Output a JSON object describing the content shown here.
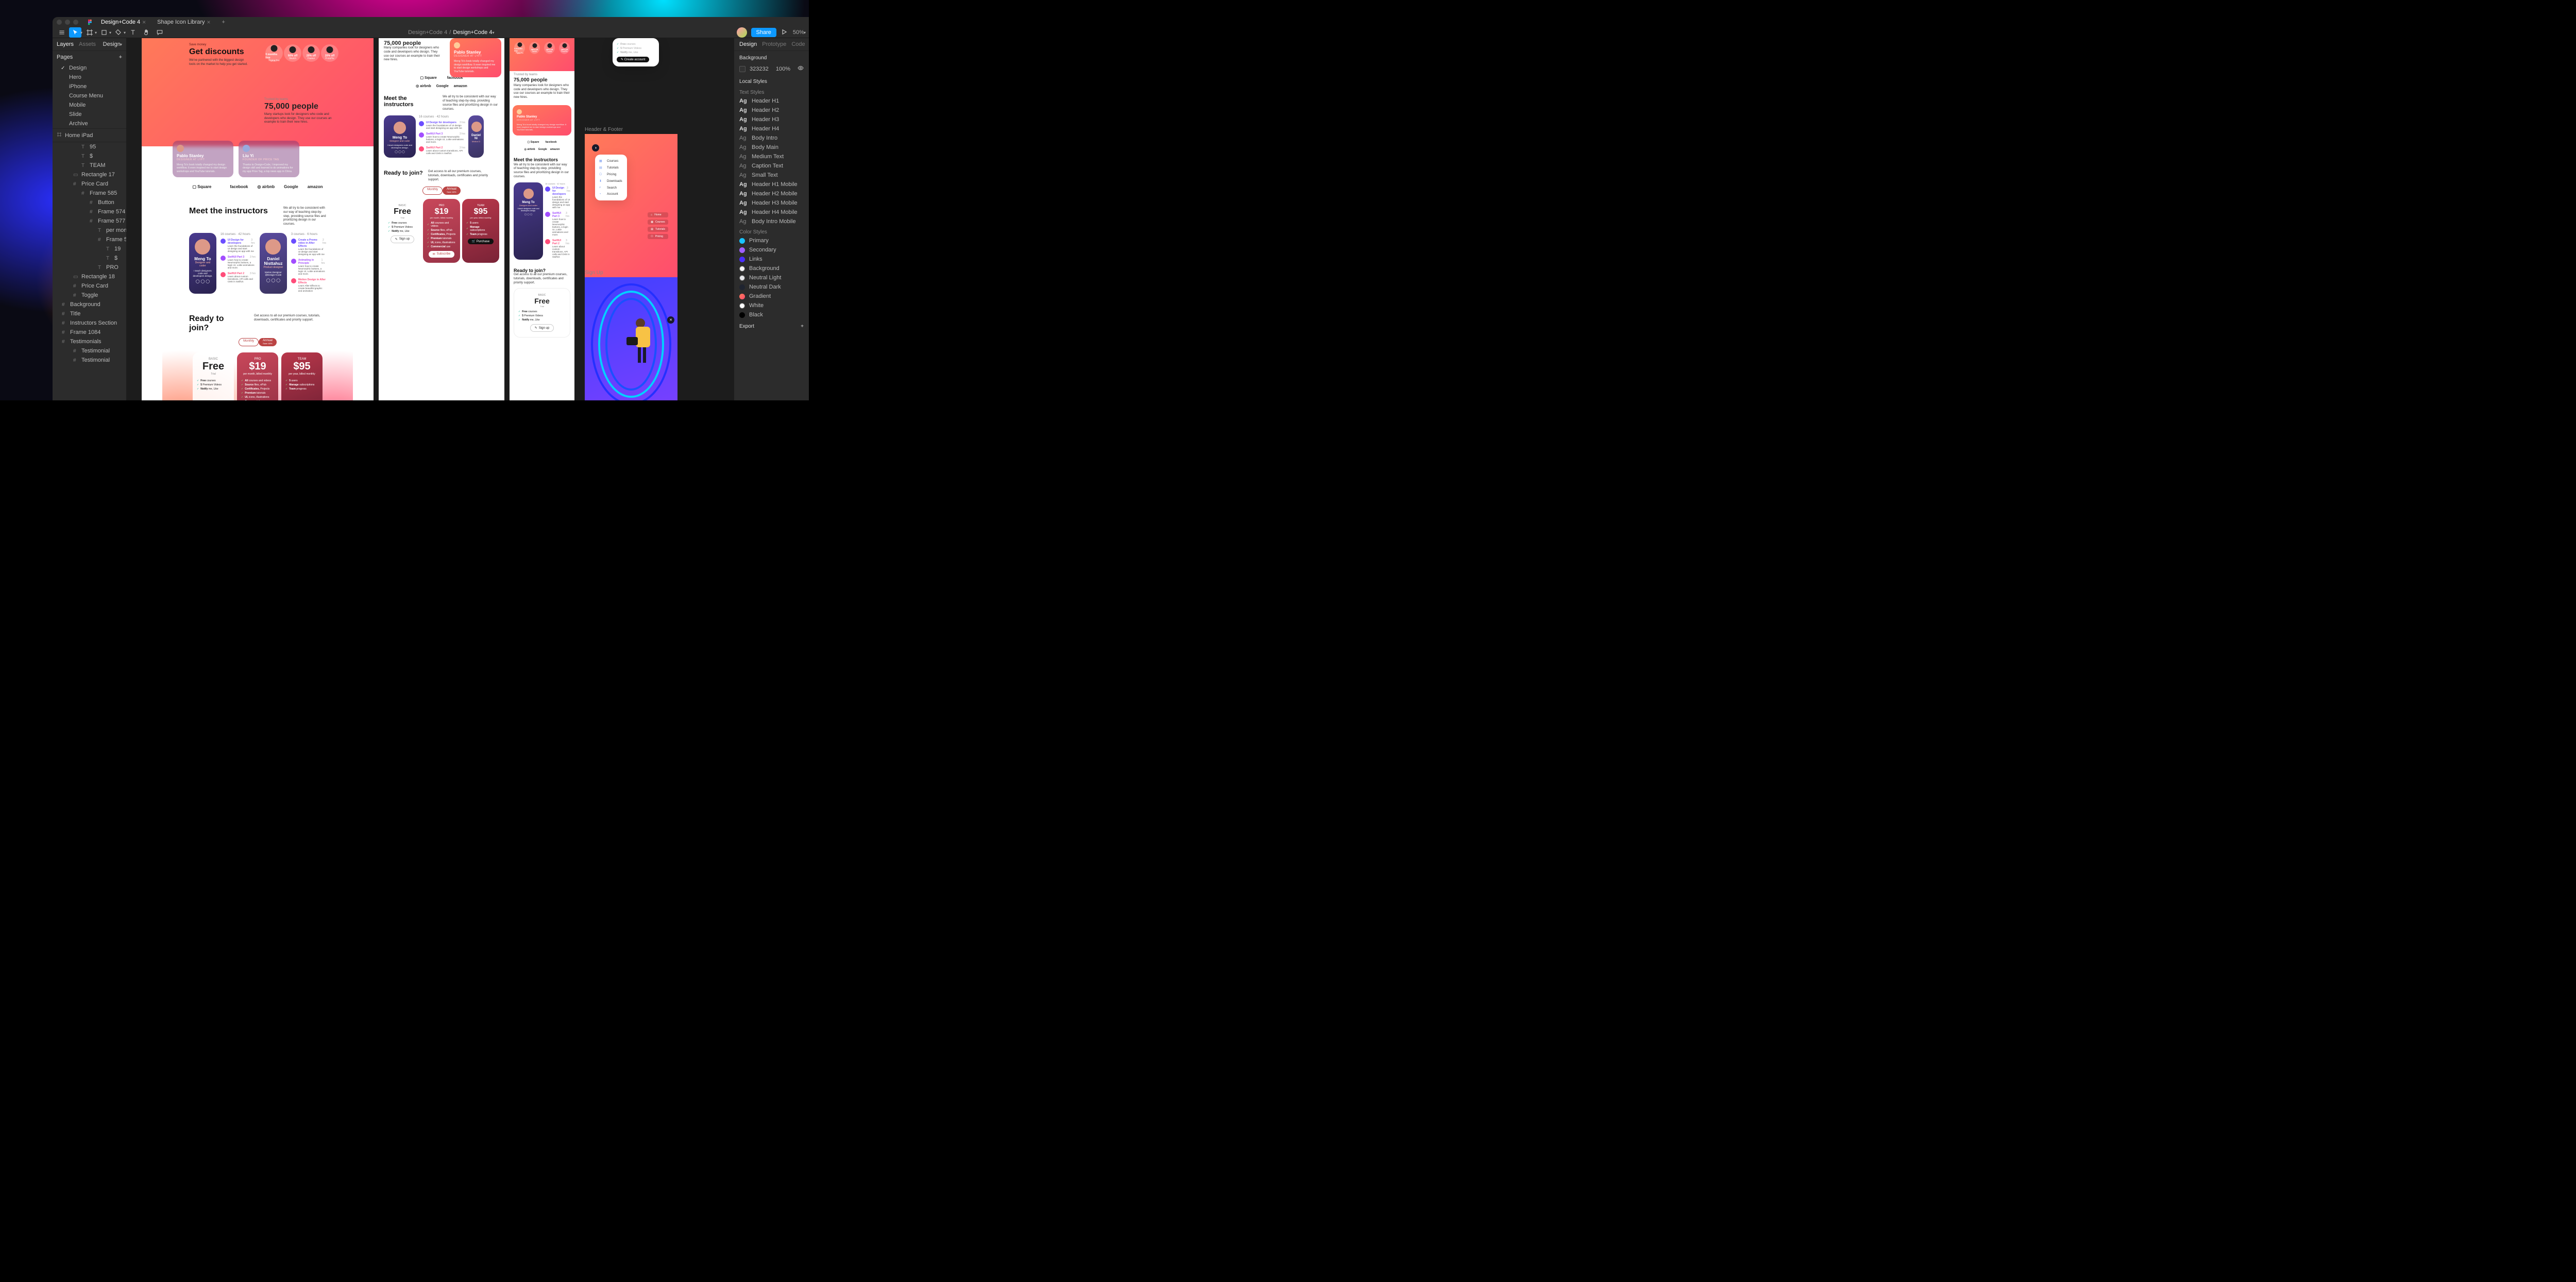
{
  "window": {
    "tab1": "Design+Code 4",
    "tab2": "Shape Icon Library",
    "breadcrumb_root": "Design+Code 4",
    "breadcrumb_page": "Design+Code 4",
    "share": "Share",
    "zoom": "50%"
  },
  "left": {
    "tabs": [
      "Layers",
      "Assets"
    ],
    "design_menu": "Design",
    "pages_label": "Pages",
    "pages": [
      "Design",
      "Hero",
      "iPhone",
      "Course Menu",
      "Mobile",
      "Slide",
      "Archive"
    ],
    "home_ipad": "Home iPad",
    "layers": [
      {
        "n": "95",
        "t": "T",
        "d": 2
      },
      {
        "n": "$",
        "t": "T",
        "d": 2
      },
      {
        "n": "TEAM",
        "t": "T",
        "d": 2
      },
      {
        "n": "Rectangle 17",
        "t": "R",
        "d": 1
      },
      {
        "n": "Price Card",
        "t": "F",
        "d": 1
      },
      {
        "n": "Frame 585",
        "t": "F",
        "d": 2
      },
      {
        "n": "Button",
        "t": "F",
        "d": 3
      },
      {
        "n": "Frame 574",
        "t": "F",
        "d": 3
      },
      {
        "n": "Frame 577",
        "t": "F",
        "d": 3
      },
      {
        "n": "per month, ...",
        "t": "T",
        "d": 4
      },
      {
        "n": "Frame 576",
        "t": "F",
        "d": 4
      },
      {
        "n": "19",
        "t": "T",
        "d": 5
      },
      {
        "n": "$",
        "t": "T",
        "d": 5
      },
      {
        "n": "PRO",
        "t": "T",
        "d": 4
      },
      {
        "n": "Rectangle 18",
        "t": "R",
        "d": 1
      },
      {
        "n": "Price Card",
        "t": "F",
        "d": 1
      },
      {
        "n": "Toggle",
        "t": "F",
        "d": 1
      },
      {
        "n": "Background",
        "t": "F",
        "d": 0
      },
      {
        "n": "Title",
        "t": "F",
        "d": 0
      },
      {
        "n": "Instructors Section",
        "t": "F",
        "d": 0
      },
      {
        "n": "Frame 1084",
        "t": "F",
        "d": 0
      },
      {
        "n": "Testimonials",
        "t": "F",
        "d": 0
      },
      {
        "n": "Testimonial",
        "t": "F",
        "d": 1
      },
      {
        "n": "Testimonial",
        "t": "F",
        "d": 1
      }
    ]
  },
  "right": {
    "tabs": [
      "Design",
      "Prototype",
      "Code"
    ],
    "bg_label": "Background",
    "bg_hex": "323232",
    "bg_opacity": "100%",
    "local_styles": "Local Styles",
    "text_styles_label": "Text Styles",
    "text_styles": [
      "Header H1",
      "Header H2",
      "Header H3",
      "Header H4",
      "Body Intro",
      "Body Main",
      "Medium Text",
      "Caption Text",
      "Small Text",
      "Header H1 Mobile",
      "Header H2 Mobile",
      "Header H3 Mobile",
      "Header H4 Mobile",
      "Body Intro Mobile"
    ],
    "color_styles_label": "Color Styles",
    "color_styles": [
      {
        "n": "Primary",
        "c": "#18c3ff"
      },
      {
        "n": "Secondary",
        "c": "#a060ff"
      },
      {
        "n": "Links",
        "c": "#4a2dff"
      },
      {
        "n": "Background",
        "c": "#f7f7f8"
      },
      {
        "n": "Neutral Light",
        "c": "#e6e7ea"
      },
      {
        "n": "Neutral Dark",
        "c": "#1f2430"
      },
      {
        "n": "Gradient",
        "c": "linear-gradient(135deg,#ff7a59,#ff4d6d)"
      },
      {
        "n": "White",
        "c": "#ffffff"
      },
      {
        "n": "Black",
        "c": "#000000"
      }
    ],
    "export": "Export"
  },
  "canvas": {
    "labels": {
      "header_footer": "Header & Footer",
      "sign_up": "Sign Up"
    },
    "discounts": {
      "pretitle": "Save money",
      "title": "Get discounts",
      "body": "We've partnered with the biggest design tools on the market to help you get started.",
      "perks": [
        {
          "t": "3 months free",
          "s": "Figma Pro"
        },
        {
          "t": "50% off",
          "s": "Sketch"
        },
        {
          "t": "20% off",
          "s": "Framer"
        },
        {
          "t": "20% off",
          "s": "ProtoPie"
        }
      ]
    },
    "testimonials": [
      {
        "name": "Pablo Stanley",
        "title": "DESIGNER AT LYFT",
        "quote": "Meng To's book totally changed my design workflow. It even inspired me to start design workshops and YouTube tutorials."
      },
      {
        "name": "Liu Yi",
        "title": "FOUNDER OF PRICE TAG",
        "quote": "Thanks to Design+Code, I improved my design skill and learned to do animations for my app Price Tag, a top news app in China."
      }
    ],
    "trust": {
      "label": "Trusted by teams",
      "headline": "75,000 people",
      "body": "Many startups look for designers who code and developers who design. They use our courses an example to train their new hires.",
      "body_alt": "Many companies look for designers who code and developers who design. They use our courses an example to train their new hires.",
      "logos": [
        "Square",
        "",
        "facebook",
        "airbnb",
        "Google",
        "amazon"
      ]
    },
    "instructors": {
      "title": "Meet the instructors",
      "sub": "We all try to be consistent with our way of teaching step-by-step, providing source files and prioritizing design in our courses.",
      "cards": [
        {
          "name": "Meng To",
          "role": "Designer and coder",
          "bio": "I teach designers code and developers design."
        },
        {
          "name": "Daniel Nisttahuz",
          "role": "Product designer",
          "bio": "Motion Designer @Design+Code"
        }
      ],
      "courses_top": "16 courses · 42 hours",
      "courses_top2": "3 courses · 6 hours",
      "courses": [
        {
          "t": "UI Design for developers",
          "h": "3 hrs",
          "d": "Learn the foundations of UI design and start designing an app with me",
          "c": "#6b4dff"
        },
        {
          "t": "SwiftUI Part 3",
          "h": "3 hrs",
          "d": "Learn how to create Neumorphic buttons, a login UI, Lottie animations and more.",
          "c": "#a24dff"
        },
        {
          "t": "SwiftUI Part 2",
          "h": "3 hrs",
          "d": "Learn about custom transitions, API calls and CMS in SwiftUI.",
          "c": "#ff4d7a"
        }
      ],
      "courses2": [
        {
          "t": "Create a Promo video in After Effects",
          "h": "2 hrs",
          "d": "Learn the foundations of UI design and start designing an app with me",
          "c": "#6b4dff"
        },
        {
          "t": "Animating in Principle",
          "h": "1 hrs",
          "d": "Learn how to create Neumorphic buttons, a login UI, Lottie animations and more.",
          "c": "#a24dff"
        },
        {
          "t": "Motion Design in After Effects",
          "h": "",
          "d": "Learn After Effects to create beautiful graphic and animation",
          "c": "#ff4d7a"
        }
      ]
    },
    "pricing": {
      "title": "Ready to join?",
      "sub": "Get access to all our premium courses, tutorials, downloads, certificates and priority support.",
      "toggle": [
        "Monthly",
        "Annual"
      ],
      "save": "Save 48%",
      "cards": [
        {
          "tier": "BASIC",
          "price": "Free",
          "sub": "Trial",
          "feat": [
            "Free courses",
            "5 Premium Videos",
            "Notify me, Like"
          ],
          "cta": "Sign up"
        },
        {
          "tier": "PRO",
          "price": "$19",
          "sub": "per month, billed monthly",
          "feat": [
            "All courses and videos",
            "Source files, ePub",
            "Certificates, Projects",
            "Premium tutorials",
            "UI, icons, illustrations",
            "Commercial use"
          ],
          "cta": "Subscribe"
        },
        {
          "tier": "TEAM",
          "price": "$95",
          "sub": "per year, billed monthly",
          "feat": [
            "5 users",
            "Manage subscriptions",
            "Team progress"
          ],
          "cta": "Purchase"
        }
      ]
    },
    "menu_popup": [
      "Courses",
      "Tutorials",
      "Pricing",
      "Downloads",
      "Search",
      "Account"
    ],
    "signup_card": {
      "feat": [
        "Free courses",
        "5 Premium Videos",
        "Notify me, Like"
      ],
      "cta": "Create account"
    },
    "nav_small": [
      "Home",
      "Courses",
      "Tutorials",
      "Pricing"
    ]
  }
}
